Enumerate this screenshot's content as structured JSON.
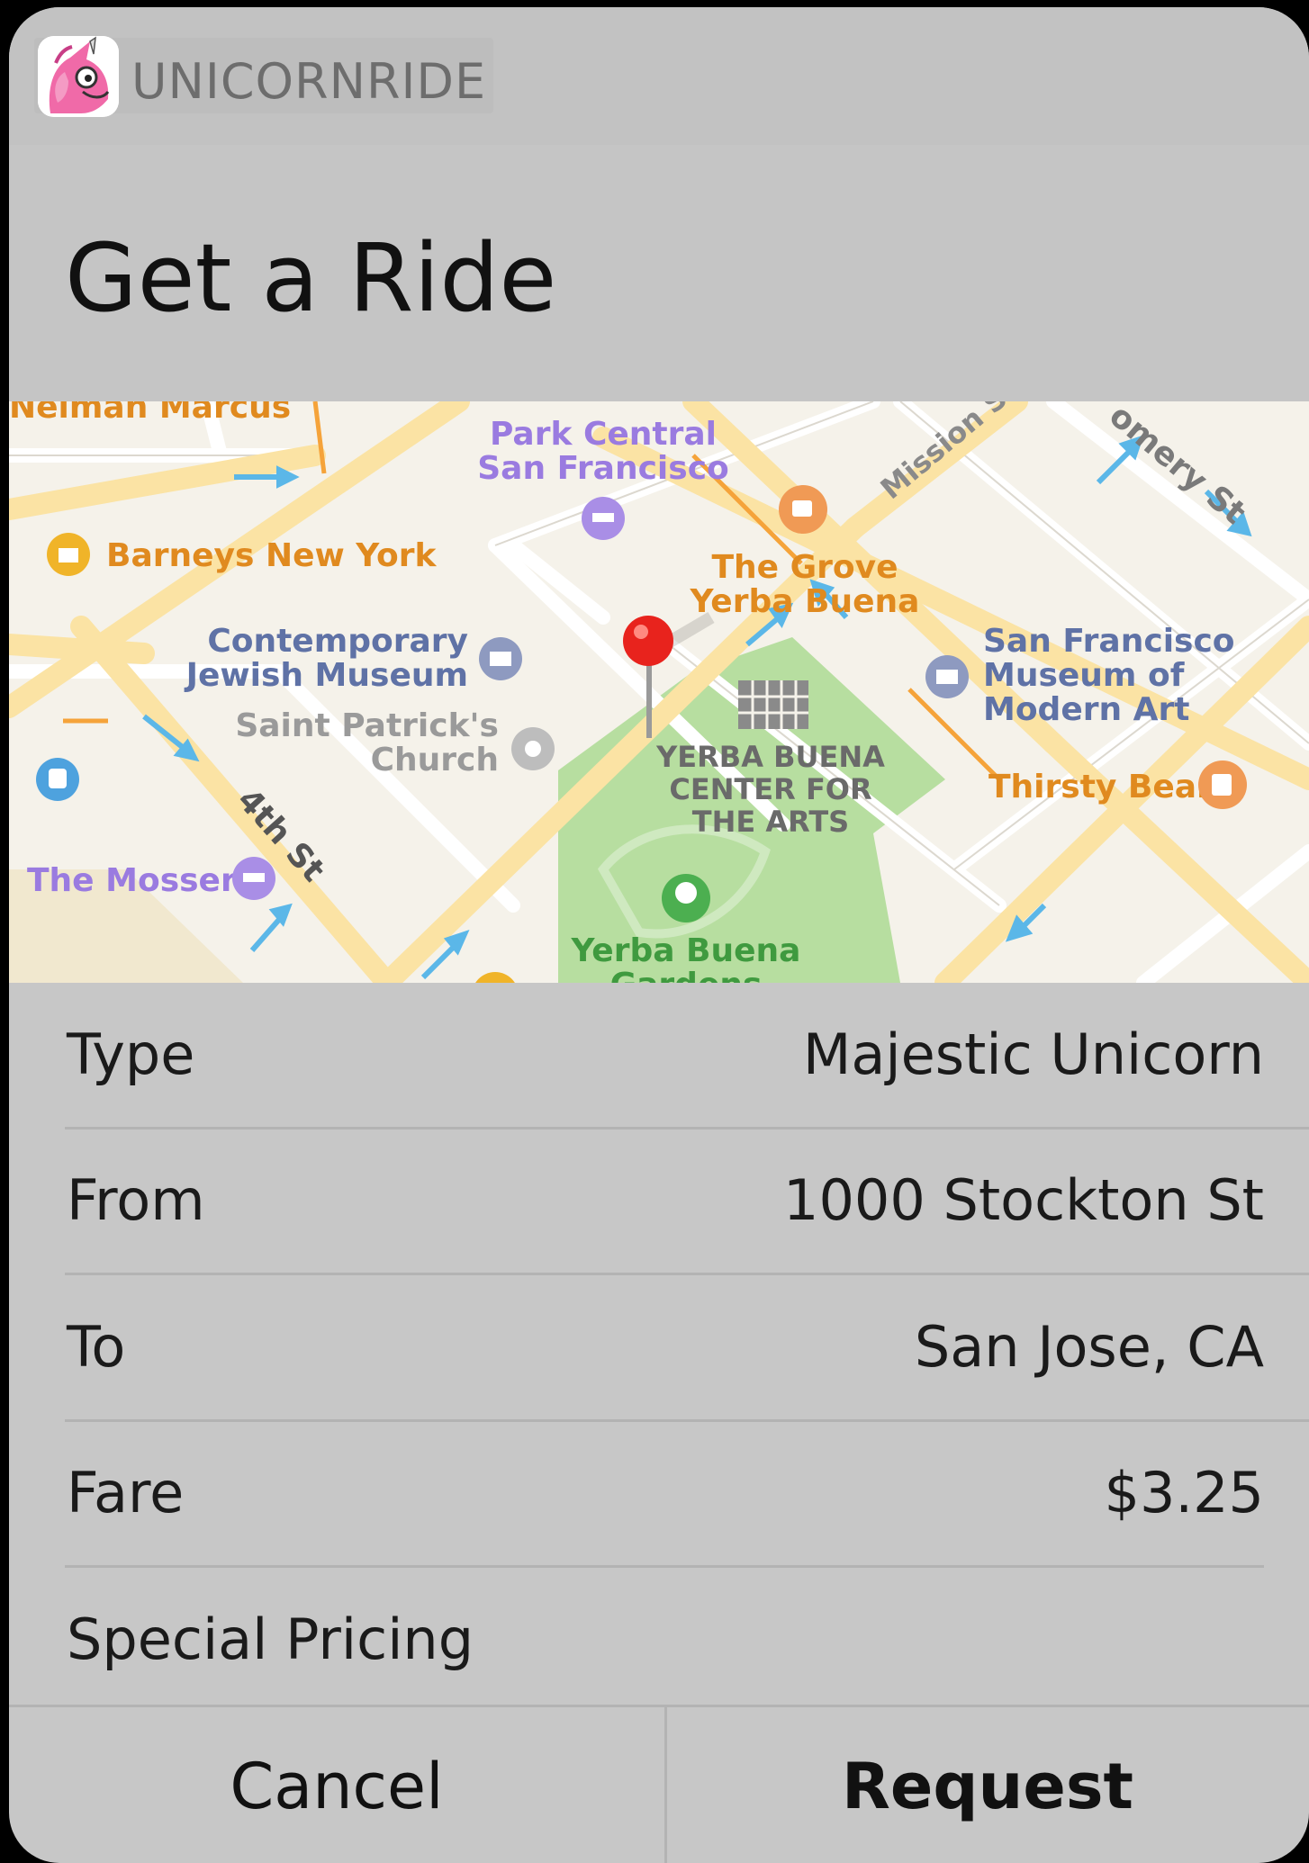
{
  "app": {
    "name": "UNICORNRIDE",
    "icon": "unicorn-icon"
  },
  "header": {
    "title": "Get a Ride"
  },
  "map": {
    "labels": {
      "neiman": "Neiman Marcus",
      "park_central_1": "Park Central",
      "park_central_2": "San Francisco",
      "mission": "Mission St",
      "montgomery": "omery St",
      "barneys": "Barneys New York",
      "grove_1": "The Grove",
      "grove_2": "Yerba Buena",
      "cjm_1": "Contemporary",
      "cjm_2": "Jewish Museum",
      "sfmoma_1": "San Francisco",
      "sfmoma_2": "Museum of",
      "sfmoma_3": "Modern Art",
      "st_patrick_1": "Saint Patrick's",
      "st_patrick_2": "Church",
      "ybca_1": "YERBA BUENA",
      "ybca_2": "CENTER FOR",
      "ybca_3": "THE ARTS",
      "thirsty": "Thirsty Bear",
      "fourth": "4th St",
      "mosser": "The Mosser",
      "gardens_1": "Yerba Buena",
      "gardens_2": "Gardens"
    }
  },
  "details": {
    "type_label": "Type",
    "type_value": "Majestic Unicorn",
    "from_label": "From",
    "from_value": "1000 Stockton St",
    "to_label": "To",
    "to_value": "San Jose, CA",
    "fare_label": "Fare",
    "fare_value": "$3.25",
    "special_label": "Special Pricing"
  },
  "actions": {
    "cancel": "Cancel",
    "request": "Request"
  },
  "colors": {
    "sheet_bg": "#c7c7c7",
    "map_bg": "#f5f2ea",
    "road": "#fbe3a4",
    "park": "#b7dea0",
    "pin": "#e8231d"
  }
}
